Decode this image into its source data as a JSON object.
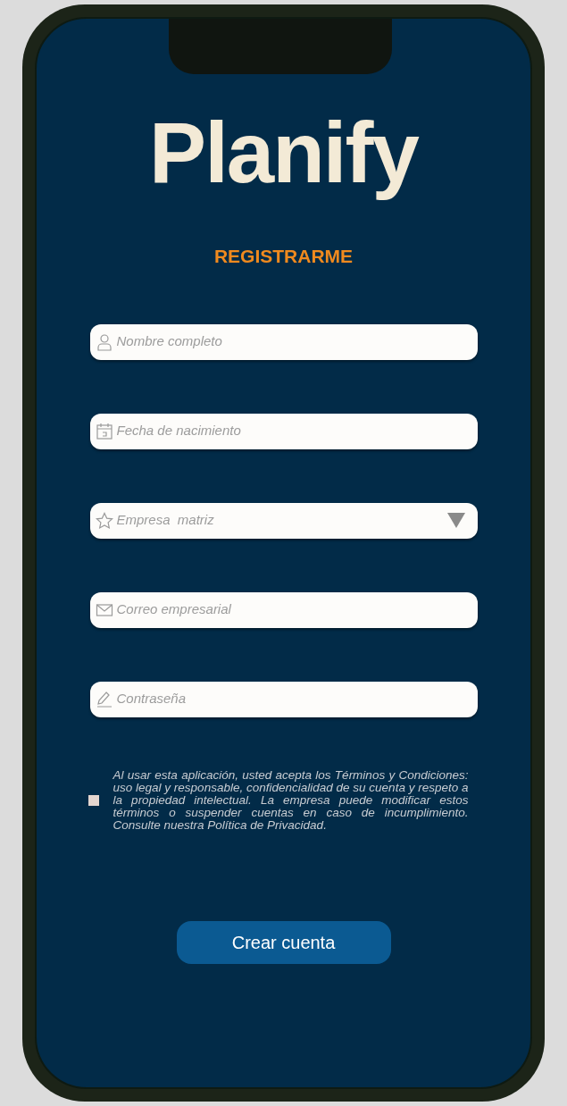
{
  "logo": "Planify",
  "title": "REGISTRARME",
  "fields": [
    {
      "kind": "text",
      "placeholder": "Nombre completo"
    },
    {
      "kind": "text",
      "placeholder": "Fecha de nacimiento"
    },
    {
      "kind": "select",
      "placeholder": "Empresa  matriz"
    },
    {
      "kind": "text",
      "placeholder": "Correo empresarial"
    },
    {
      "kind": "password",
      "placeholder": "Contraseña"
    }
  ],
  "terms": {
    "checked": false,
    "text": "Al usar esta aplicación, usted acepta los Términos y Condiciones: uso legal y responsable, confidencialidad de su cuenta y respeto a la propiedad intelectual. La empresa puede modificar estos términos o suspender cuentas en caso de incumplimiento. Consulte nuestra Política de Privacidad."
  },
  "submit": "Crear cuenta"
}
